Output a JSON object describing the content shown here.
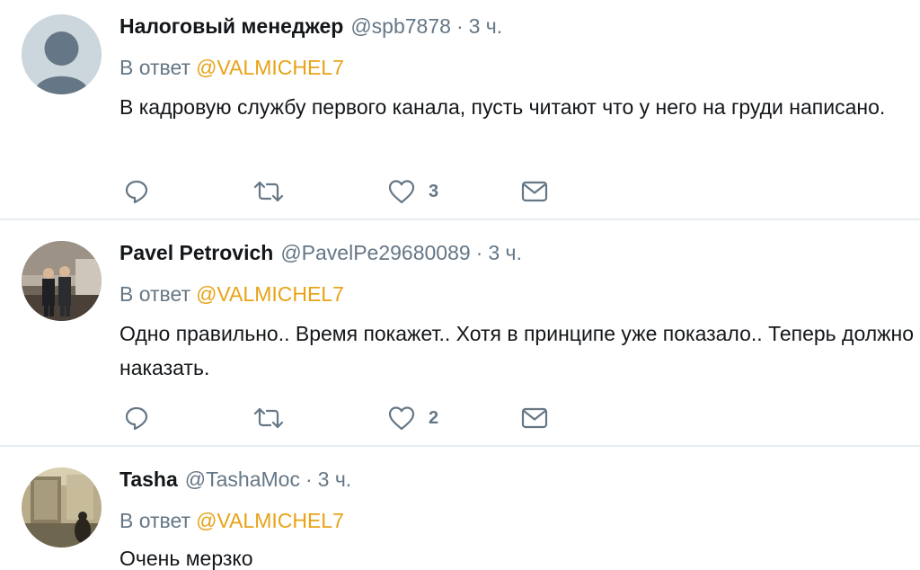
{
  "tweets": [
    {
      "name": "Налоговый менеджер",
      "handle": "@spb7878",
      "time": "3 ч.",
      "reply_prefix": "В ответ",
      "reply_mention": "@VALMICHEL7",
      "text": "В кадровую службу первого канала, пусть читают что у него на груди написано.",
      "likes": "3",
      "avatar": "default-avatar"
    },
    {
      "name": "Pavel Petrovich",
      "handle": "@PavelPe29680089",
      "time": "3 ч.",
      "reply_prefix": "В ответ",
      "reply_mention": "@VALMICHEL7",
      "text": "Одно правильно.. Время покажет.. Хотя в принципе уже показало.. Теперь должно наказать.",
      "likes": "2",
      "avatar": "photo-avatar"
    },
    {
      "name": "Tasha",
      "handle": "@TashaMoc",
      "time": "3 ч.",
      "reply_prefix": "В ответ",
      "reply_mention": "@VALMICHEL7",
      "text": "Очень мерзко",
      "avatar": "photo-avatar"
    }
  ],
  "separator": "·",
  "colors": {
    "accent": "#e8a317",
    "secondary_text": "#657786",
    "divider": "#e6ecf0"
  },
  "icons": [
    "reply-icon",
    "retweet-icon",
    "like-icon",
    "message-icon"
  ]
}
